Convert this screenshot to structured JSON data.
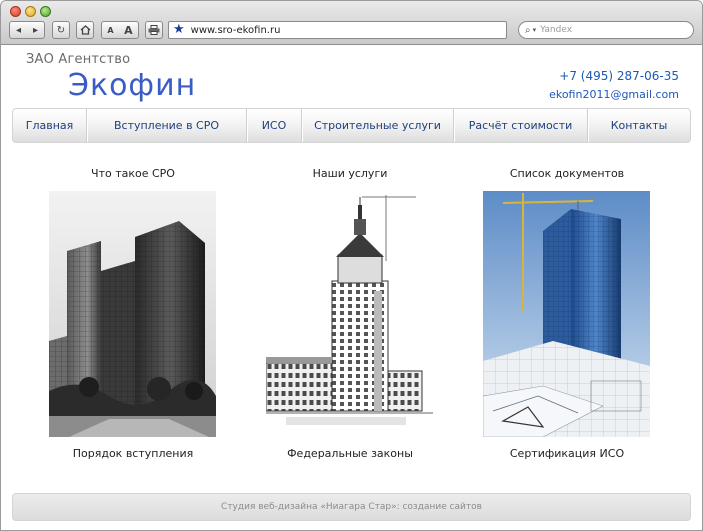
{
  "browser": {
    "url": "www.sro-ekofin.ru",
    "search_placeholder": "Yandex",
    "back_label": "◂",
    "forward_label": "▸",
    "text_small_label": "A",
    "text_large_label": "A"
  },
  "header": {
    "logo_sub": "ЗАО Агентство",
    "logo_main": "Экофин",
    "phone": "+7 (495) 287-06-35",
    "email": "ekofin2011@gmail.com"
  },
  "nav": {
    "items": [
      {
        "label": "Главная"
      },
      {
        "label": "Вступление в СРО"
      },
      {
        "label": "ИСО"
      },
      {
        "label": "Строительные услуги"
      },
      {
        "label": "Расчёт стоимости"
      },
      {
        "label": "Контакты"
      }
    ]
  },
  "sections": [
    {
      "top_label": "Что такое СРО",
      "bottom_label": "Порядок вступления",
      "image": "skyscrapers-photo"
    },
    {
      "top_label": "Наши услуги",
      "bottom_label": "Федеральные законы",
      "image": "building-blueprint-drawing"
    },
    {
      "top_label": "Список документов",
      "bottom_label": "Сертификация ИСО",
      "image": "glass-tower-with-crane"
    }
  ],
  "footer": {
    "text": "Студия веб-дизайна «Ниагара Стар»: создание сайтов"
  },
  "colors": {
    "accent": "#3b5cc4",
    "link": "#1e58b8",
    "nav_text": "#1e3f7c"
  }
}
